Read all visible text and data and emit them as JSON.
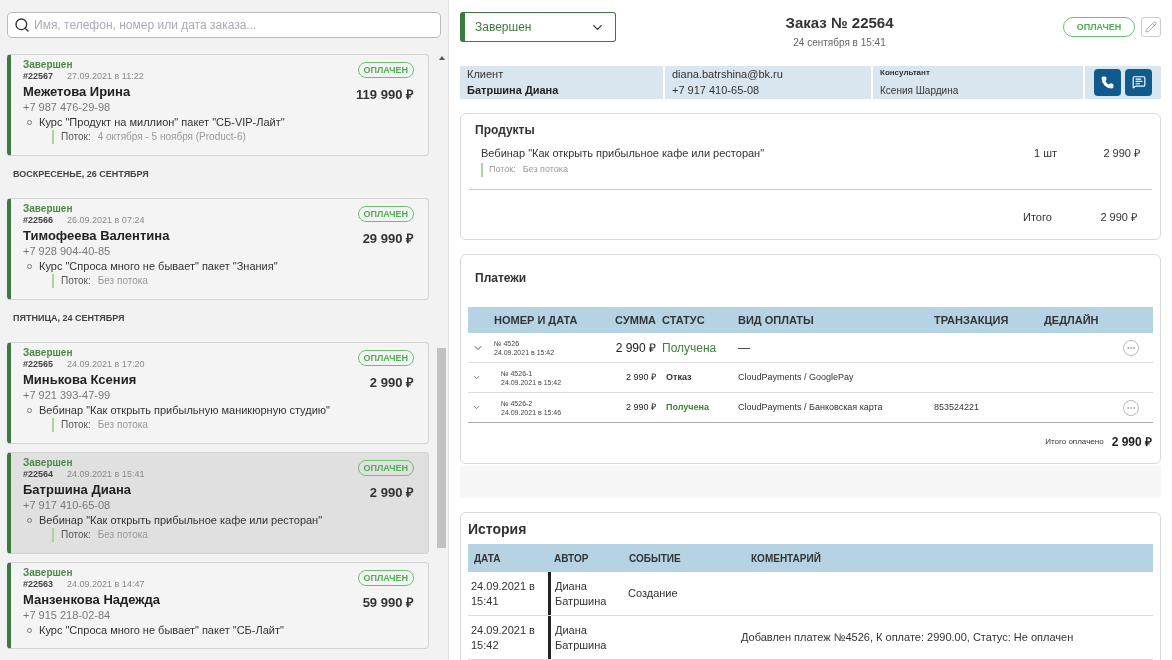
{
  "search": {
    "placeholder": "Имя, телефон, номер или дата заказа..."
  },
  "order_list": [
    {
      "kind": "order",
      "status": "Завершен",
      "number": "#22567",
      "date": "27.09.2021 в 11:22",
      "name": "Межетова Ирина",
      "phone": "+7 987 476-29-98",
      "price": "119 990 ₽",
      "badge": "ОПЛАЧЕН",
      "selected": false,
      "products": [
        {
          "title": "Курс \"Продукт на миллион\" пакет \"СБ-VIP-Лайт\"",
          "stream_label": "Поток:",
          "stream": "4 октября - 5 ноября (Product-6)"
        }
      ]
    },
    {
      "kind": "date",
      "label": "ВОСКРЕСЕНЬЕ, 26 СЕНТЯБРЯ"
    },
    {
      "kind": "order",
      "status": "Завершен",
      "number": "#22566",
      "date": "26.09.2021 в 07:24",
      "name": "Тимофеева Валентина",
      "phone": "+7 928 904-40-85",
      "price": "29 990 ₽",
      "badge": "ОПЛАЧЕН",
      "selected": false,
      "products": [
        {
          "title": "Курс \"Спроса много не бывает\" пакет \"Знания\"",
          "stream_label": "Поток:",
          "stream": "Без потока"
        }
      ]
    },
    {
      "kind": "date",
      "label": "ПЯТНИЦА, 24 СЕНТЯБРЯ"
    },
    {
      "kind": "order",
      "status": "Завершен",
      "number": "#22565",
      "date": "24.09.2021 в 17:20",
      "name": "Минькова Ксения",
      "phone": "+7 921 393-47-99",
      "price": "2 990 ₽",
      "badge": "ОПЛАЧЕН",
      "selected": false,
      "products": [
        {
          "title": "Вебинар \"Как открыть прибыльную маникюрную студию\"",
          "stream_label": "Поток:",
          "stream": "Без потока"
        }
      ]
    },
    {
      "kind": "order",
      "status": "Завершен",
      "number": "#22564",
      "date": "24.09.2021 в 15:41",
      "name": "Батршина Диана",
      "phone": "+7 917 410-65-08",
      "price": "2 990 ₽",
      "badge": "ОПЛАЧЕН",
      "selected": true,
      "products": [
        {
          "title": "Вебинар \"Как открыть прибыльное кафе или ресторан\"",
          "stream_label": "Поток:",
          "stream": "Без потока"
        }
      ]
    },
    {
      "kind": "order",
      "status": "Завершен",
      "number": "#22563",
      "date": "24.09.2021 в 14:47",
      "name": "Манзенкова Надежда",
      "phone": "+7 915 218-02-84",
      "price": "59 990 ₽",
      "badge": "ОПЛАЧЕН",
      "selected": false,
      "products": [
        {
          "title": "Курс \"Спроса много не бывает\" пакет \"СБ-Лайт\""
        }
      ]
    }
  ],
  "order": {
    "status_select": "Завершен",
    "title": "Заказ № 22564",
    "date": "24 сентября в 15:41",
    "badge": "ОПЛАЧЕН"
  },
  "client": {
    "label": "Клиент",
    "name": "Батршина Диана",
    "email": "diana.batrshina@bk.ru",
    "phone": "+7 917 410-65-08",
    "consultant_label": "Консультант",
    "consultant": "Ксения Шардина"
  },
  "products": {
    "title": "Продукты",
    "items": [
      {
        "title": "Вебинар \"Как открыть прибыльное кафе или ресторан\"",
        "stream_label": "Поток:",
        "stream": "Без потока",
        "qty": "1 шт",
        "price": "2 990 ₽"
      }
    ],
    "total_label": "Итого",
    "total": "2 990 ₽"
  },
  "payments": {
    "title": "Платежи",
    "columns": [
      "НОМЕР И ДАТА",
      "СУММА",
      "СТАТУС",
      "ВИД ОПЛАТЫ",
      "ТРАНЗАКЦИЯ",
      "ДЕДЛАЙН"
    ],
    "rows": [
      {
        "kind": "main",
        "number": "№ 4526",
        "date": "24.09.2021 в 15:42",
        "sum": "2 990 ₽",
        "status": "Получена",
        "color": "#3f7f3a",
        "method": "—",
        "menu": true
      },
      {
        "kind": "sub",
        "number": "№ 4526-1",
        "date": "24.09.2021 в 15:42",
        "sum": "2 990 ₽",
        "status": "Отказ",
        "color": "#333333",
        "method": "CloudPayments / GooglePay",
        "menu": false
      },
      {
        "kind": "sub",
        "number": "№ 4526-2",
        "date": "24.09.2021 в 15:46",
        "sum": "2 990 ₽",
        "status": "Получена",
        "color": "#3f7f3a",
        "method": "CloudPayments / Банковская карта",
        "transaction": "853524221",
        "menu": true
      }
    ],
    "total_label": "Итого оплачено",
    "total": "2 990 ₽"
  },
  "history": {
    "title": "История",
    "columns": [
      "ДАТА",
      "АВТОР",
      "СОБЫТИЕ",
      "КОМЕНТАРИЙ"
    ],
    "rows": [
      {
        "date": "24.09.2021 в 15:41",
        "author": "Диана Батршина",
        "event": "Создание"
      },
      {
        "date": "24.09.2021 в 15:42",
        "author": "Диана Батршина",
        "comment": "Добавлен платеж №4526, К оплате: 2990.00, Статус: Не оплачен"
      }
    ]
  }
}
